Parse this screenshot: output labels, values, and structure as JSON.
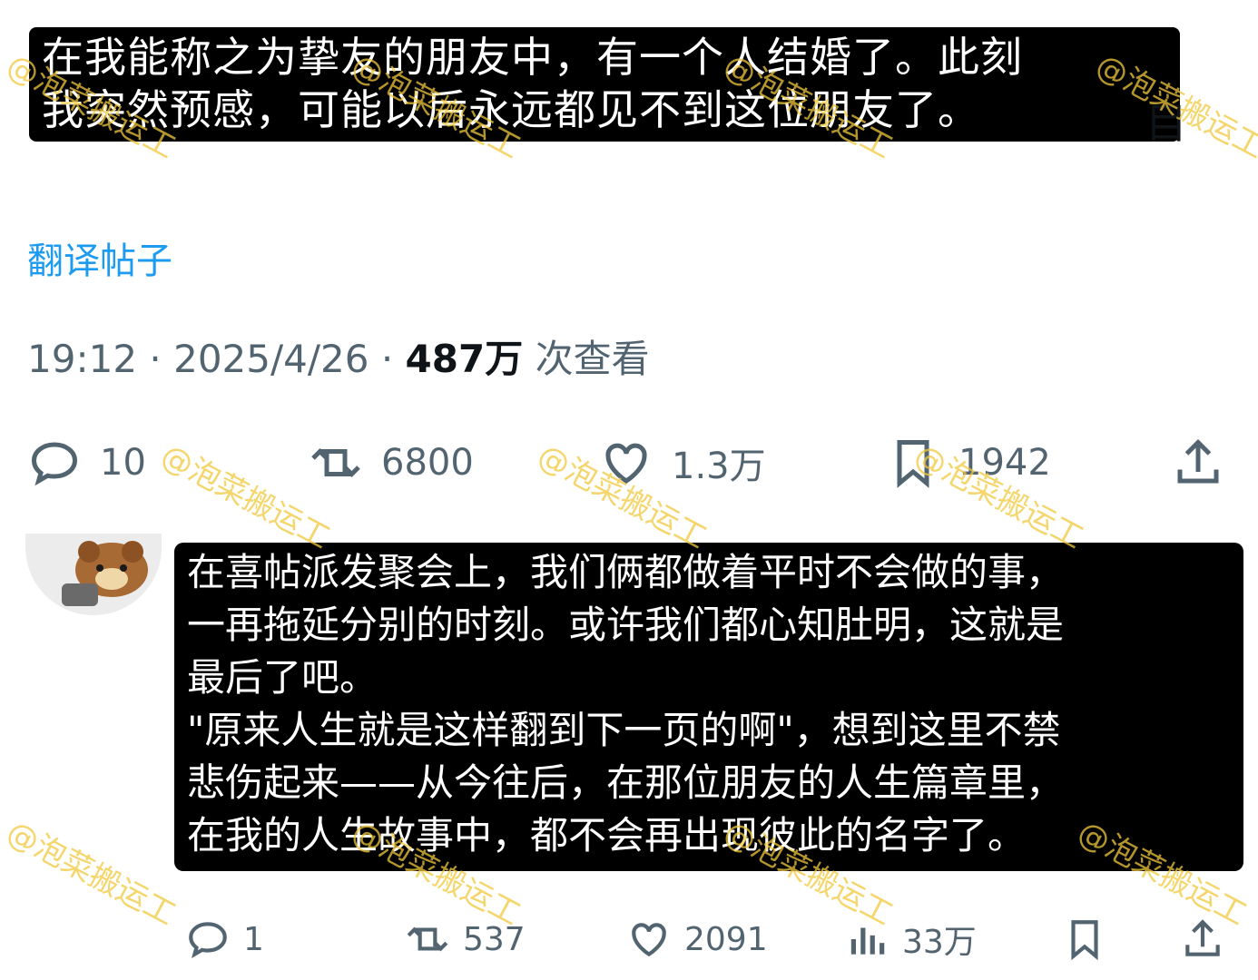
{
  "post": {
    "text": "在我能称之为挚友的朋友中，有一个人结婚了。此刻\n我突然预感，可能以后永远都见不到这位朋友了。",
    "peek_text": "目",
    "translate_label": "翻译帖子",
    "time": "19:12",
    "date": "2025/4/26",
    "views_count": "487万",
    "views_label": "次查看",
    "actions": {
      "reply": "10",
      "retweet": "6800",
      "like": "1.3万",
      "bookmark": "1942"
    }
  },
  "reply": {
    "text": "在喜帖派发聚会上，我们俩都做着平时不会做的事，\n一再拖延分别的时刻。或许我们都心知肚明，这就是\n最后了吧。\n\"原来人生就是这样翻到下一页的啊\"，想到这里不禁\n悲伤起来——从今往后，在那位朋友的人生篇章里，\n在我的人生故事中，都不会再出现彼此的名字了。",
    "actions": {
      "reply": "1",
      "retweet": "537",
      "like": "2091",
      "views": "33万"
    }
  },
  "watermark": "@泡菜搬运工",
  "colors": {
    "accent": "#1d9bf0",
    "muted": "#536471",
    "watermark": "#f0c83c"
  }
}
